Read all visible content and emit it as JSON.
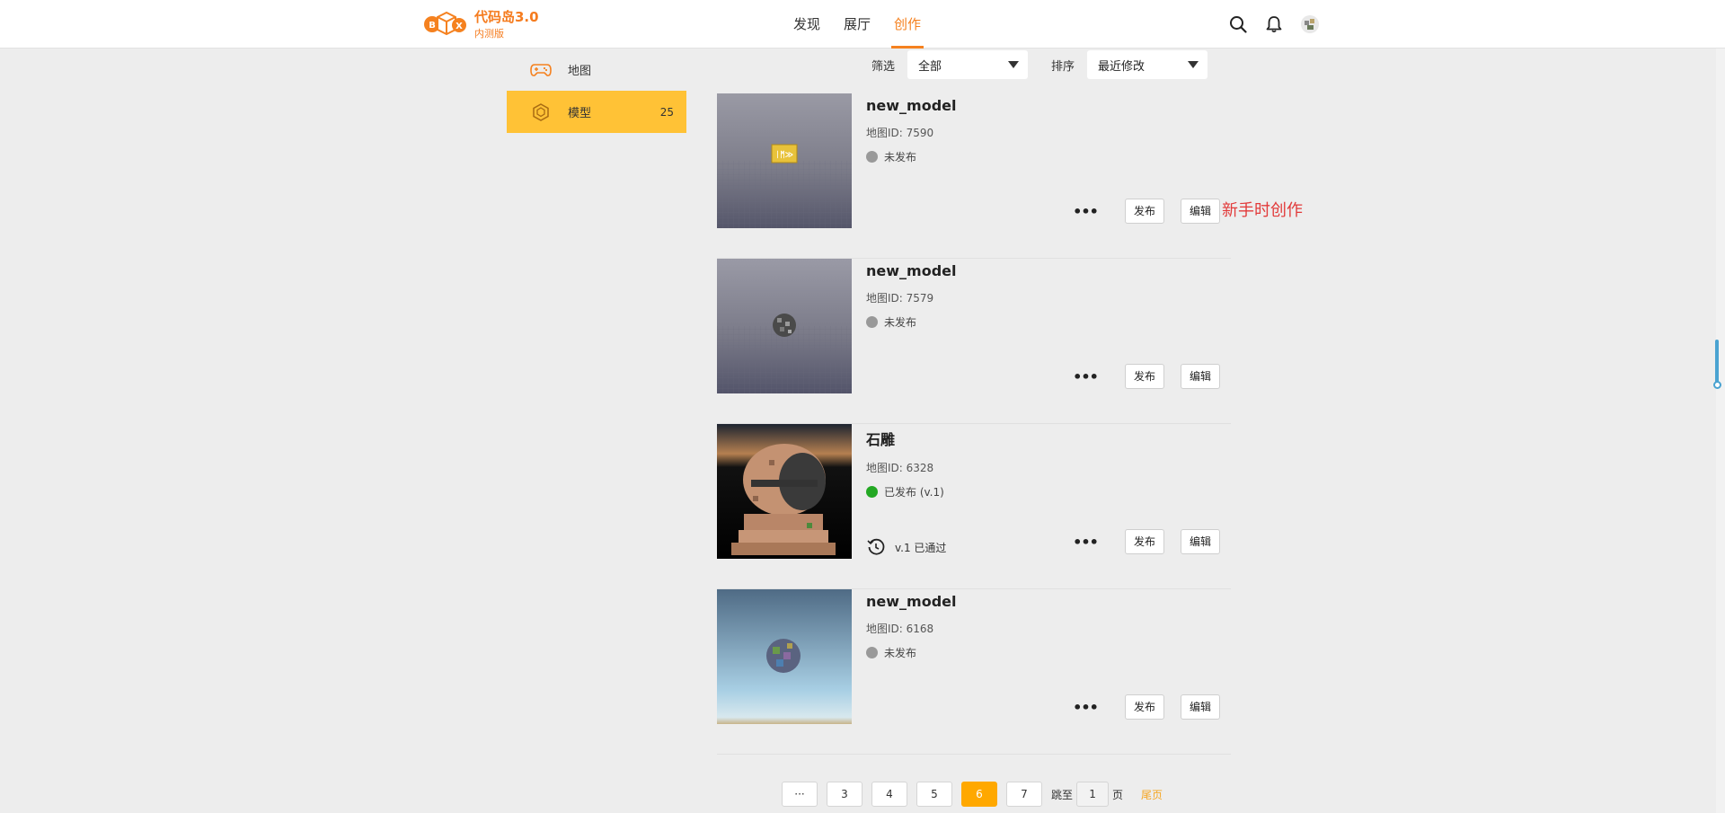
{
  "header": {
    "logo_title": "代码岛3.0",
    "logo_sub": "内测版",
    "nav": [
      {
        "label": "发现",
        "active": false
      },
      {
        "label": "展厅",
        "active": false
      },
      {
        "label": "创作",
        "active": true
      }
    ],
    "icons": [
      "search-icon",
      "bell-icon",
      "avatar"
    ]
  },
  "sidebar": {
    "items": [
      {
        "label": "地图",
        "icon": "gamepad-icon",
        "count": "",
        "active": false
      },
      {
        "label": "模型",
        "icon": "cube-icon",
        "count": "25",
        "active": true
      }
    ]
  },
  "filters": {
    "filter_label": "筛选",
    "filter_value": "全部",
    "sort_label": "排序",
    "sort_value": "最近修改"
  },
  "items": [
    {
      "title": "new_model",
      "mapid": "地图ID: 7590",
      "status": "未发布",
      "published": false
    },
    {
      "title": "new_model",
      "mapid": "地图ID: 7579",
      "status": "未发布",
      "published": false
    },
    {
      "title": "石雕",
      "mapid": "地图ID: 6328",
      "status": "已发布 (v.1)",
      "published": true,
      "review": "v.1 已通过"
    },
    {
      "title": "new_model",
      "mapid": "地图ID: 6168",
      "status": "未发布",
      "published": false
    }
  ],
  "actions": {
    "more": "•••",
    "publish": "发布",
    "edit": "编辑"
  },
  "annotation": "新手时创作",
  "thumb_badge": "ᛁᛗ≫",
  "pagination": {
    "ellipsis": "···",
    "pages": [
      "3",
      "4",
      "5",
      "6",
      "7"
    ],
    "current": "6",
    "jump_prefix": "跳至",
    "jump_value": "1",
    "jump_suffix": "页",
    "last": "尾页"
  },
  "colors": {
    "accent": "#f5811f",
    "sidebar_active": "#ffc236",
    "page_active": "#ffa800",
    "published": "#23a823",
    "unpublished": "#999999",
    "annotation": "#e23a3a"
  }
}
